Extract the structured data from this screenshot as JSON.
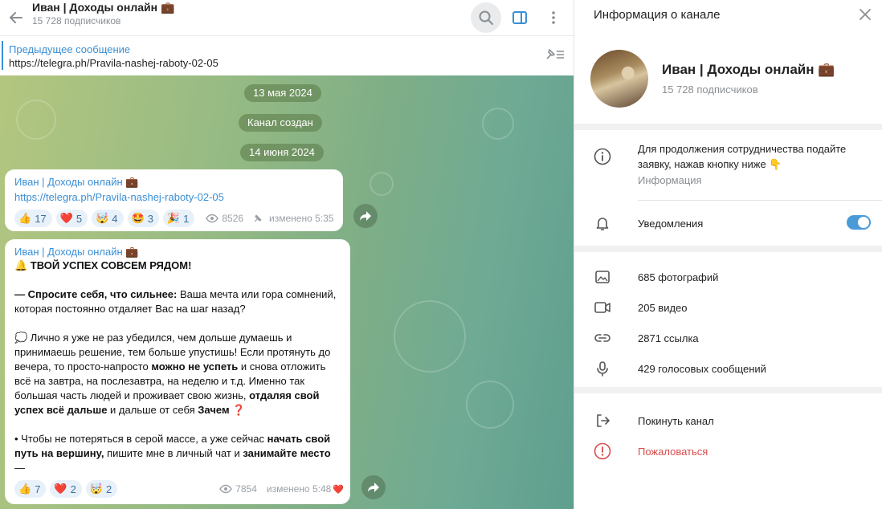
{
  "header": {
    "title": "Иван | Доходы онлайн 💼",
    "subscribers": "15 728 подписчиков"
  },
  "pinned": {
    "title": "Предыдущее сообщение",
    "link": "https://telegra.ph/Pravila-nashej-raboty-02-05"
  },
  "pills": {
    "date1": "13 мая 2024",
    "created": "Канал создан",
    "date2": "14 июня 2024"
  },
  "msg1": {
    "author": "Иван | Доходы онлайн 💼",
    "link": "https://telegra.ph/Pravila-nashej-raboty-02-05",
    "reactions": [
      {
        "emoji": "👍",
        "count": "17"
      },
      {
        "emoji": "❤️",
        "count": "5"
      },
      {
        "emoji": "🤯",
        "count": "4"
      },
      {
        "emoji": "🤩",
        "count": "3"
      },
      {
        "emoji": "🎉",
        "count": "1"
      }
    ],
    "views": "8526",
    "edited": "изменено 5:35"
  },
  "msg2": {
    "author": "Иван | Доходы онлайн 💼",
    "heading": "🔔 ТВОЙ УСПЕХ СОВСЕМ РЯДОМ!",
    "p1_bold": "— Спросите себя, что сильнее:",
    "p1_rest": " Ваша мечта или гора сомнений, которая постоянно отдаляет Вас на шаг назад?",
    "p2_a": "💭 Лично я уже не раз убедился, чем дольше думаешь и принимаешь решение, тем больше упустишь! Если протянуть до вечера, то просто-напросто ",
    "p2_b": "можно не успеть",
    "p2_c": " и снова отложить всё на завтра, на послезавтра, на неделю и т.д. Именно так большая часть людей и проживает свою жизнь, ",
    "p2_d": "отдаляя свой успех всё дальше",
    "p2_e": " и дальше от себя ",
    "p2_f": "Зачем ❓",
    "p3_a": "• Чтобы не потеряться в серой массе, а уже сейчас ",
    "p3_b": "начать свой путь на вершину,",
    "p3_c": " пишите мне в личный чат и ",
    "p3_d": "занимайте место",
    "p3_e": " —",
    "reactions": [
      {
        "emoji": "👍",
        "count": "7"
      },
      {
        "emoji": "❤️",
        "count": "2"
      },
      {
        "emoji": "🤯",
        "count": "2"
      }
    ],
    "views": "7854",
    "edited": "изменено 5:48",
    "own_reaction": "❤️"
  },
  "panel": {
    "title": "Информация о канале",
    "name": "Иван | Доходы онлайн 💼",
    "subscribers": "15 728 подписчиков",
    "info_text": "Для продолжения сотрудничества подайте заявку, нажав кнопку ниже 👇",
    "info_label": "Информация",
    "notifications": "Уведомления",
    "notifications_on": true,
    "photos": "685 фотографий",
    "videos": "205 видео",
    "links": "2871 ссылка",
    "voice": "429 голосовых сообщений",
    "leave": "Покинуть канал",
    "report": "Пожаловаться"
  },
  "colors": {
    "accent": "#3a8fd6",
    "danger": "#d94c4c",
    "toggle": "#4a9ad8"
  }
}
